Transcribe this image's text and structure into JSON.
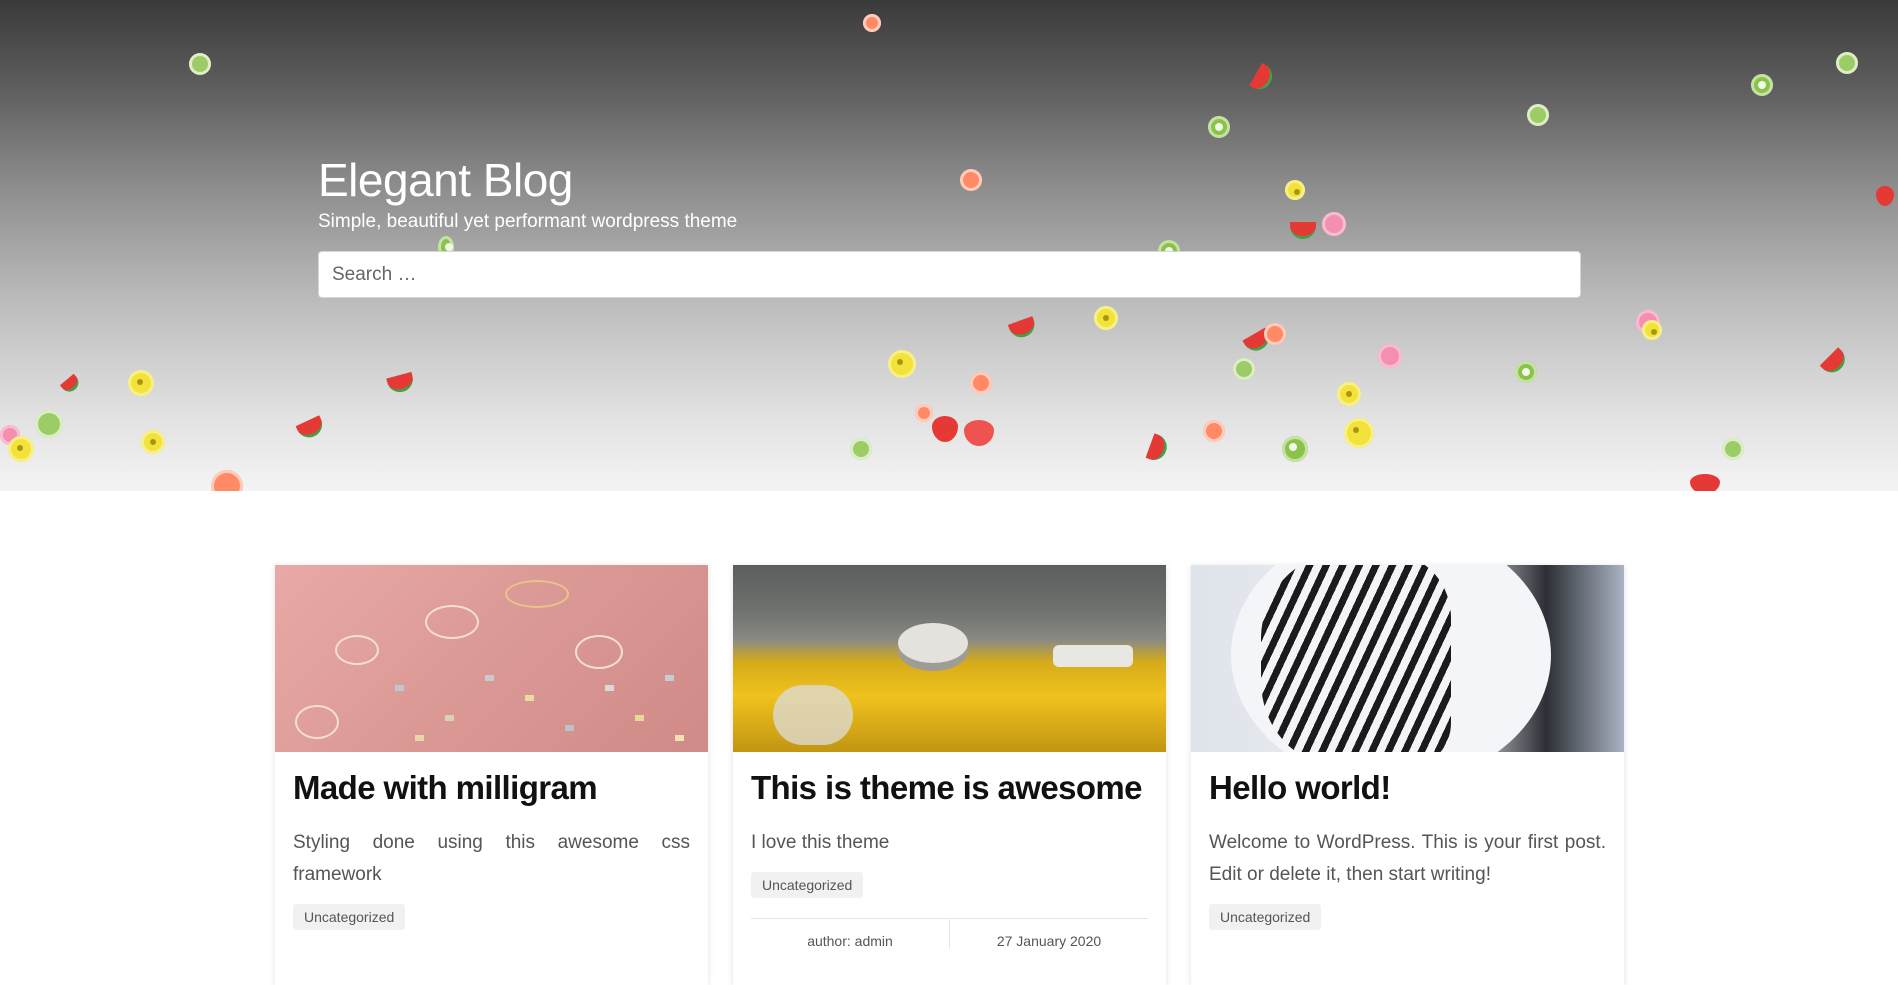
{
  "site": {
    "title": "Elegant Blog",
    "tagline": "Simple, beautiful yet performant wordpress theme"
  },
  "search": {
    "placeholder": "Search …"
  },
  "posts": [
    {
      "title": "Made with milligram",
      "excerpt": "Styling done using this awesome css framework",
      "category": "Uncategorized",
      "image": "confetti-photo"
    },
    {
      "title": "This is theme is awesome",
      "excerpt": "I love this theme",
      "category": "Uncategorized",
      "author": "author: admin",
      "date": "27 January 2020",
      "image": "yellow-console-photo"
    },
    {
      "title": "Hello world!",
      "excerpt": "Welcome to WordPress. This is your first post. Edit or delete it, then start writing!",
      "category": "Uncategorized",
      "image": "striped-shirt-photo"
    }
  ],
  "colors": {
    "hero_top": "#3a3a3a",
    "hero_bottom": "#f4f4f4",
    "title": "#ffffff",
    "card_title": "#111111",
    "category_bg": "#f1f1f1"
  }
}
